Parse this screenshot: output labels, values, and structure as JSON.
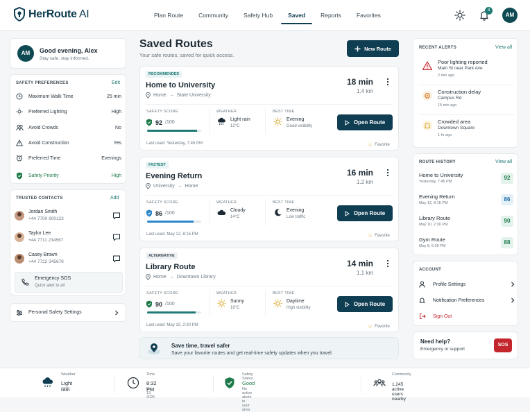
{
  "brand": {
    "name_bold": "HerRoute",
    "name_light": " AI"
  },
  "nav": [
    "Plan Route",
    "Community",
    "Safety Hub",
    "Saved",
    "Reports",
    "Favorites"
  ],
  "nav_active": "Saved",
  "notifications_count": "3",
  "user_initials": "AM",
  "greeting": {
    "title": "Good evening, Alex",
    "subtitle": "Stay safe, stay informed."
  },
  "safety_prefs": {
    "title": "Safety Preferences",
    "edit": "Edit",
    "items": [
      {
        "label": "Maximum Walk Time",
        "value": "25 min",
        "icon": "clock-icon"
      },
      {
        "label": "Preferred Lighting",
        "value": "High",
        "icon": "sun-icon"
      },
      {
        "label": "Avoid Crowds",
        "value": "No",
        "icon": "people-icon"
      },
      {
        "label": "Avoid Construction",
        "value": "Yes",
        "icon": "warning-icon"
      },
      {
        "label": "Preferred Time",
        "value": "Evenings",
        "icon": "alarm-icon"
      },
      {
        "label": "Safety Priority",
        "value": "High",
        "icon": "shield-icon"
      }
    ]
  },
  "contacts": {
    "title": "Trusted Contacts",
    "add": "Add",
    "items": [
      {
        "name": "Jordan Smith",
        "phone": "+44 7700 900123"
      },
      {
        "name": "Taylor Lee",
        "phone": "+44 7711 234567"
      },
      {
        "name": "Casey Brown",
        "phone": "+44 7722 345678"
      }
    ],
    "sos": {
      "title": "Emergency SOS",
      "subtitle": "Quick alert to all"
    }
  },
  "personal_settings": "Personal Safety Settings",
  "page": {
    "title": "Saved Routes",
    "subtitle": "Your safe routes, saved for quick access.",
    "new_route": "New Route"
  },
  "labels": {
    "safety_score": "Safety Score",
    "weather": "Weather",
    "best_time": "Best Time",
    "open_route": "Open Route",
    "favorite": "Favorite",
    "of": "/100"
  },
  "routes": [
    {
      "tag": "Recommended",
      "name": "Home to University",
      "from": "Home",
      "to": "State University",
      "time": "18 min",
      "distance": "1.4 km",
      "score": 92,
      "weather": "Light rain",
      "temp": "12°C",
      "best": "Evening",
      "best_sub": "Good visibility",
      "last_used": "Last used: Yesterday, 7:45 PM"
    },
    {
      "tag": "Fastest",
      "name": "Evening Return",
      "from": "University",
      "to": "Home",
      "time": "16 min",
      "distance": "1.2 km",
      "score": 86,
      "weather": "Cloudy",
      "temp": "14°C",
      "best": "Evening",
      "best_sub": "Low traffic",
      "last_used": "Last used: May 12, 8:15 PM"
    },
    {
      "tag": "Alternative",
      "name": "Library Route",
      "from": "Home",
      "to": "Downtown Library",
      "time": "14 min",
      "distance": "1.1 km",
      "score": 90,
      "weather": "Sunny",
      "temp": "16°C",
      "best": "Daytime",
      "best_sub": "High visibility",
      "last_used": "Last used: May 10, 2:30 PM"
    }
  ],
  "tip": {
    "title": "Save time, travel safer",
    "subtitle": "Save your favorite routes and get real-time safety updates when you travel."
  },
  "alerts": {
    "title": "Recent Alerts",
    "view_all": "View all",
    "items": [
      {
        "title": "Poor lighting reported",
        "location": "Main St near Park Ave",
        "time": "2 min ago",
        "color": "#c4262e"
      },
      {
        "title": "Construction delay",
        "location": "Campus Rd",
        "time": "15 min ago",
        "color": "#d9822b"
      },
      {
        "title": "Crowded area",
        "location": "Downtown Square",
        "time": "1 hr ago",
        "color": "#d8a92a"
      }
    ]
  },
  "history": {
    "title": "Route History",
    "view_all": "View all",
    "items": [
      {
        "name": "Home to University",
        "date": "Yesterday, 7:45 PM",
        "score": "92"
      },
      {
        "name": "Evening Return",
        "date": "May 12, 8:15 PM",
        "score": "86"
      },
      {
        "name": "Library Route",
        "date": "May 10, 2:30 PM",
        "score": "90"
      },
      {
        "name": "Gym Route",
        "date": "May 8, 6:20 PM",
        "score": "88"
      }
    ]
  },
  "account": {
    "title": "Account",
    "profile": "Profile Settings",
    "notifications": "Notification Preferences",
    "sign_out": "Sign Out"
  },
  "help": {
    "title": "Need help?",
    "subtitle": "Emergency or support",
    "sos": "SOS"
  },
  "status": {
    "weather": {
      "label": "Weather",
      "value": "Light rain",
      "sub": "12°C"
    },
    "time": {
      "label": "Time",
      "value": "8:32 PM",
      "sub": "May 13, 2025"
    },
    "safety": {
      "label": "Safety Status",
      "value": "Good",
      "sub": "No active alerts in your area"
    },
    "community": {
      "label": "Community",
      "value": "1,245 active users nearby"
    }
  },
  "colors": {
    "primary": "#0f3d52",
    "accent": "#1f7a74",
    "success": "#1f7a4a",
    "danger": "#c4262e"
  }
}
